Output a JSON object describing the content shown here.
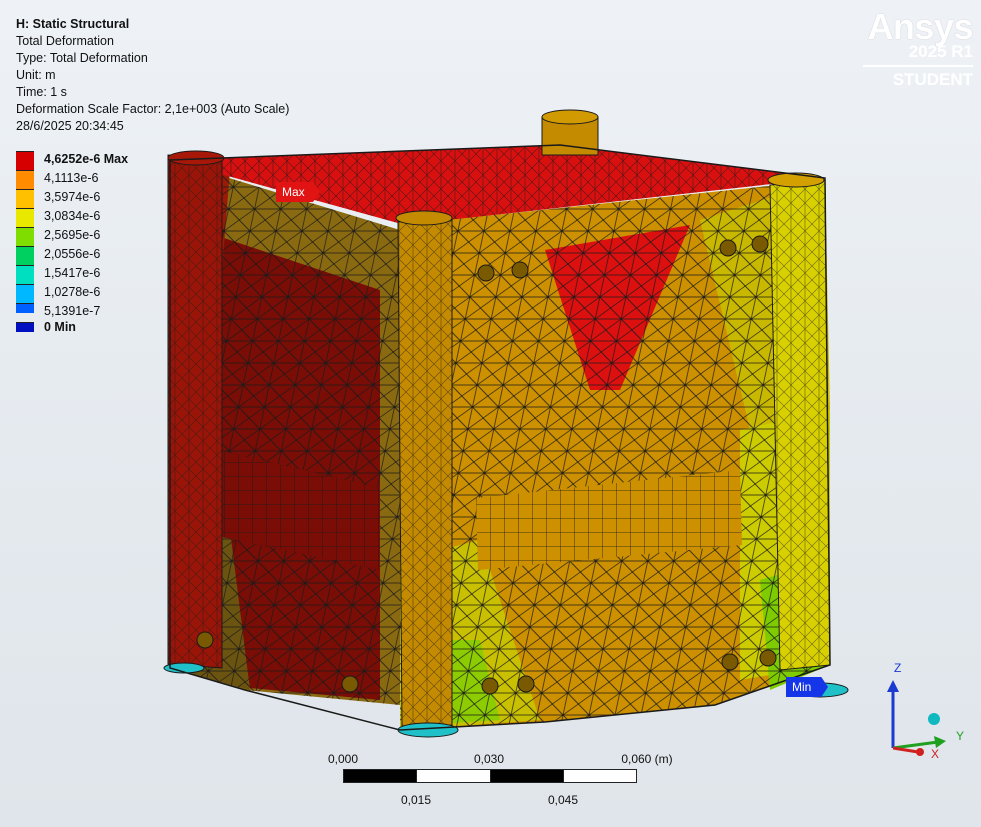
{
  "header": {
    "system": "H: Static Structural",
    "result_name": "Total Deformation",
    "type": "Type: Total Deformation",
    "unit": "Unit: m",
    "time": "Time: 1 s",
    "scale_factor": "Deformation Scale Factor: 2,1e+003 (Auto Scale)",
    "timestamp": "28/6/2025 20:34:45"
  },
  "legend": {
    "entries": [
      {
        "label": "4,6252e-6 Max",
        "color": "#d60000",
        "bold": true
      },
      {
        "label": "4,1113e-6",
        "color": "#ff8c00"
      },
      {
        "label": "3,5974e-6",
        "color": "#ffc000"
      },
      {
        "label": "3,0834e-6",
        "color": "#e8e800"
      },
      {
        "label": "2,5695e-6",
        "color": "#7fdd00"
      },
      {
        "label": "2,0556e-6",
        "color": "#00d060"
      },
      {
        "label": "1,5417e-6",
        "color": "#00e0c0"
      },
      {
        "label": "1,0278e-6",
        "color": "#00b8ff"
      },
      {
        "label": "5,1391e-7",
        "color": "#0060ff"
      },
      {
        "label": "0 Min",
        "color": "#0010c0",
        "bold": true
      }
    ]
  },
  "brand": {
    "name": "Ansys",
    "version": "2025 R1",
    "edition": "STUDENT"
  },
  "probes": {
    "max_label": "Max",
    "min_label": "Min"
  },
  "scale_bar": {
    "top_labels": [
      "0,000",
      "0,030",
      "0,060 (m)"
    ],
    "bottom_labels": [
      "0,015",
      "0,045"
    ]
  },
  "triad": {
    "x": "X",
    "y": "Y",
    "z": "Z"
  },
  "colors": {
    "max_tag": "#e21313",
    "min_tag": "#1535e8",
    "mesh_line": "#1a1a1a"
  }
}
